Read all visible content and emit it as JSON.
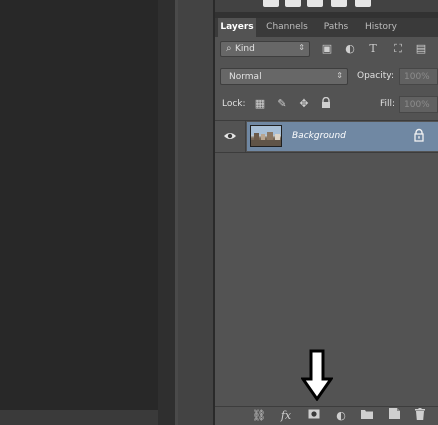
{
  "panel_tabs": [
    {
      "label": "Layers",
      "active": true
    },
    {
      "label": "Channels",
      "active": false
    },
    {
      "label": "Paths",
      "active": false
    },
    {
      "label": "History",
      "active": false
    }
  ],
  "filter": {
    "kind_label": "Kind",
    "icons": [
      "image-filter-icon",
      "adjustment-filter-icon",
      "type-filter-icon",
      "shape-filter-icon",
      "smart-object-filter-icon"
    ]
  },
  "blend": {
    "mode": "Normal",
    "opacity_label": "Opacity:",
    "opacity_value": "100%"
  },
  "lock": {
    "label": "Lock:",
    "icons": [
      "lock-transparent-pixels-icon",
      "lock-image-pixels-icon",
      "lock-position-icon",
      "lock-all-icon"
    ],
    "fill_label": "Fill:",
    "fill_value": "100%"
  },
  "layers": [
    {
      "name": "Background",
      "visible": true,
      "locked": true,
      "selected": true
    }
  ],
  "bottom_icons": [
    "link-layers-icon",
    "fx-icon",
    "add-mask-icon",
    "adjustment-layer-icon",
    "new-group-icon",
    "new-layer-icon",
    "delete-layer-icon"
  ],
  "colors": {
    "panel_bg": "#535353",
    "selected_layer": "#7088a3",
    "canvas_bg": "#282828"
  }
}
